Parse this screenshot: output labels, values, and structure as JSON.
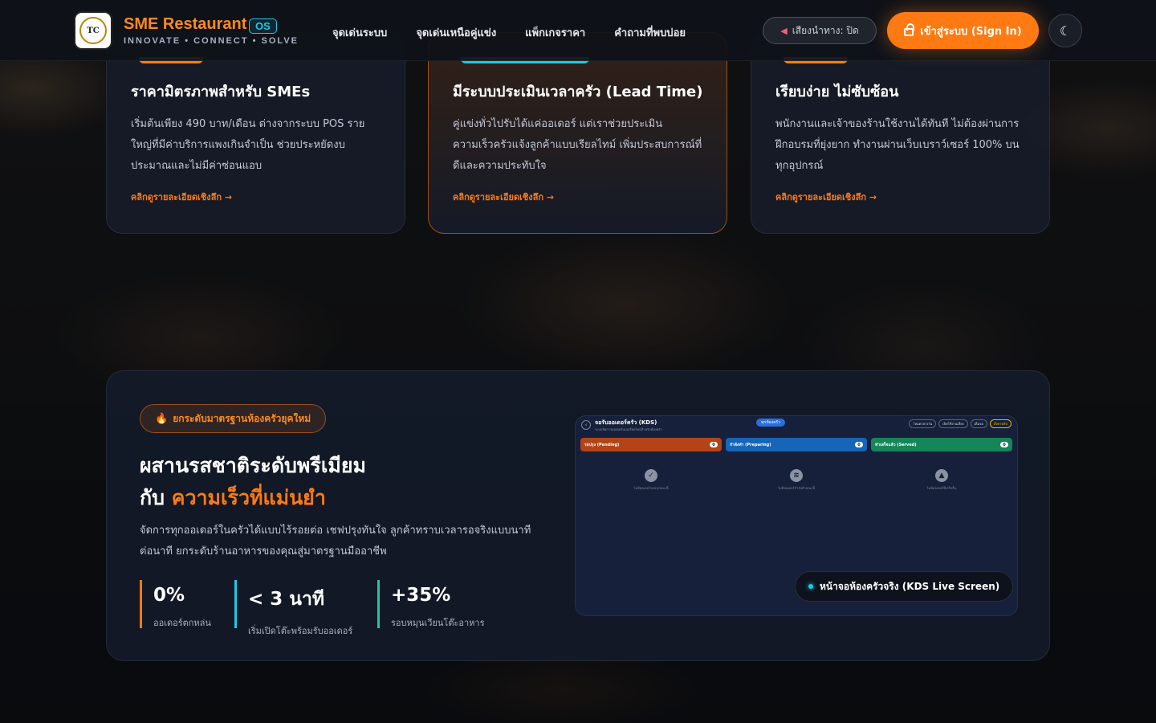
{
  "brand": {
    "logo_text": "TC",
    "title": "SME Restaurant",
    "badge": "OS",
    "tagline": "INNOVATE • CONNECT • SOLVE"
  },
  "nav": {
    "links": [
      "จุดเด่นระบบ",
      "จุดเด่นเหนือคู่แข่ง",
      "แพ็กเกจราคา",
      "คำถามที่พบบ่อย"
    ],
    "sound_label": "เสียงนำทาง: ปิด",
    "sound_icon": "mute-speaker-icon",
    "signin_label": "เข้าสู่ระบบ (Sign In)",
    "theme_icon": "moon-icon"
  },
  "cards": [
    {
      "title": "ราคามิตรภาพสำหรับ SMEs",
      "desc": "เริ่มต้นเพียง 490 บาท/เดือน ต่างจากระบบ POS รายใหญ่ที่มีค่าบริการแพงเกินจำเป็น ช่วยประหยัดงบประมาณและไม่มีค่าซ่อนแอบ",
      "link": "คลิกดูรายละเอียดเชิงลึก →"
    },
    {
      "title": "มีระบบประเมินเวลาครัว (Lead Time)",
      "desc": "คู่แข่งทั่วไปรับได้แค่ออเดอร์ แต่เราช่วยประเมินความเร็วครัวแจ้งลูกค้าแบบเรียลไทม์ เพิ่มประสบการณ์ที่ดีและความประทับใจ",
      "link": "คลิกดูรายละเอียดเชิงลึก →"
    },
    {
      "title": "เรียบง่าย ไม่ซับซ้อน",
      "desc": "พนักงานและเจ้าของร้านใช้งานได้ทันที ไม่ต้องผ่านการฝึกอบรมที่ยุ่งยาก ทำงานผ่านเว็บเบราว์เซอร์ 100% บนทุกอุปกรณ์",
      "link": "คลิกดูรายละเอียดเชิงลึก →"
    }
  ],
  "section": {
    "pill": "ยกระดับมาตรฐานห้องครัวยุคใหม่",
    "headline_line1": "ผสานรสชาติระดับพรีเมียม",
    "headline_prefix": "กับ",
    "headline_accent": "ความเร็วที่แม่นยำ",
    "sub": "จัดการทุกออเดอร์ในครัวได้แบบไร้รอยต่อ เชฟปรุงทันใจ ลูกค้าทราบเวลารอจริงแบบนาทีต่อนาที ยกระดับร้านอาหารของคุณสู่มาตรฐานมืออาชีพ",
    "stats": [
      {
        "value": "0%",
        "label": "ออเดอร์ตกหล่น"
      },
      {
        "value": "< 3 นาที",
        "label": "เริ่มเปิดโต๊ะพร้อมรับออเดอร์"
      },
      {
        "value": "+35%",
        "label": "รอบหมุนเวียนโต๊ะอาหาร"
      }
    ],
    "kds_badge": "หน้าจอห้องครัวจริง (KDS Live Screen)"
  },
  "kds": {
    "title": "จอรับออเดอร์ครัว (KDS)",
    "subtitle": "ระบบจัดการออเดอร์แบบเรียลไทม์สำหรับห้องครัว",
    "chip": "ทุกห้องครัว",
    "actions": [
      "โหมดกลางวัน",
      "เปิดใช้งานเสียง",
      "เต็มจอ",
      "ตั้งค่าคลิป"
    ],
    "columns": [
      {
        "label": "รอปรุง (Pending)",
        "count": "0",
        "empty_icon": "check-circle-icon",
        "empty": "ไม่มีออเดอร์รอปรุงขณะนี้"
      },
      {
        "label": "กำลังทำ (Preparing)",
        "count": "0",
        "empty_icon": "cooking-pot-icon",
        "empty": "ไม่มีออเดอร์กำลังทำขณะนี้"
      },
      {
        "label": "ทำเสร็จแล้ว (Served)",
        "count": "0",
        "empty_icon": "thumbs-up-icon",
        "empty": "ไม่มีออเดอร์ที่เสร็จสิ้น"
      }
    ]
  }
}
